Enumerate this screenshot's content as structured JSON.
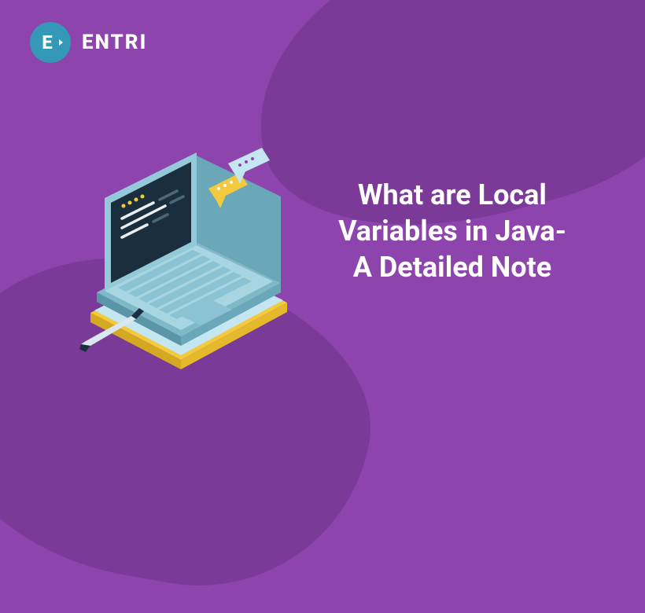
{
  "logo": {
    "letter": "E",
    "text": "ENTRI"
  },
  "headline": {
    "line1": "What are Local",
    "line2": "Variables in Java-",
    "line3": "A Detailed Note"
  }
}
